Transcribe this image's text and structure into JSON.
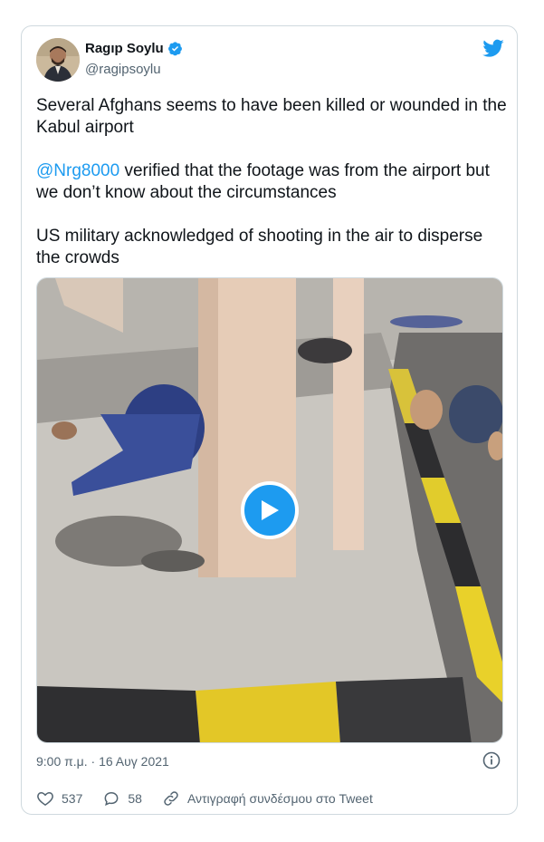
{
  "top_text": "…",
  "tweet": {
    "author_name": "Ragıp Soylu",
    "author_handle": "@ragipsoylu",
    "paragraph1": "Several Afghans seems to have been killed or wounded in the Kabul airport",
    "mention": "@Nrg8000",
    "paragraph2_rest": " verified that the footage was from the airport but we don’t know about the circumstances",
    "paragraph3": "US military acknowledged of shooting in the air to disperse the crowds",
    "timestamp": "9:00 π.μ. · 16 Αυγ 2021",
    "likes": "537",
    "replies": "58",
    "copy_link_label": "Αντιγραφή συνδέσμου στο Tweet"
  },
  "icons": {
    "verified": "verified-badge-icon",
    "logo": "twitter-bird-icon",
    "play": "play-icon",
    "info": "info-icon",
    "like": "heart-icon",
    "reply": "speech-bubble-icon",
    "link": "link-icon"
  },
  "colors": {
    "accent": "#1d9bf0",
    "text": "#0f1419",
    "secondary": "#536471",
    "border": "#cfd9de"
  }
}
